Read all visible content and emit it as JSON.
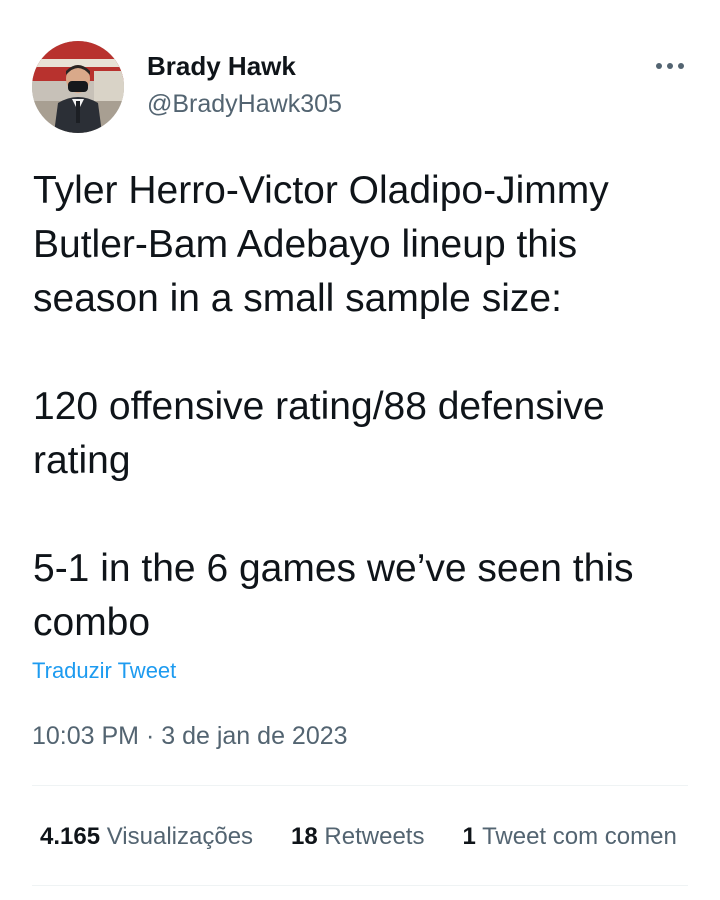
{
  "author": {
    "name": "Brady Hawk",
    "handle": "@BradyHawk305",
    "avatar_icon": "user-avatar-photo"
  },
  "more_icon": "more-options-icon",
  "tweet": {
    "text": "Tyler Herro-Victor Oladipo-Jimmy Butler-Bam Adebayo lineup this season in a small sample size:\n\n120 offensive rating/88 defensive rating\n\n5-1 in the 6 games we’ve seen this combo",
    "translate_label": "Traduzir Tweet",
    "time": "10:03 PM",
    "separator": "·",
    "date": "3 de jan de 2023"
  },
  "stats": {
    "views": {
      "count": "4.165",
      "label": "Visualizações"
    },
    "retweets": {
      "count": "18",
      "label": "Retweets"
    },
    "quotes": {
      "count": "1",
      "label": "Tweet com comen"
    }
  },
  "colors": {
    "text": "#0f1419",
    "secondary": "#536471",
    "link": "#1d9bf0",
    "divider": "#eff3f4"
  }
}
